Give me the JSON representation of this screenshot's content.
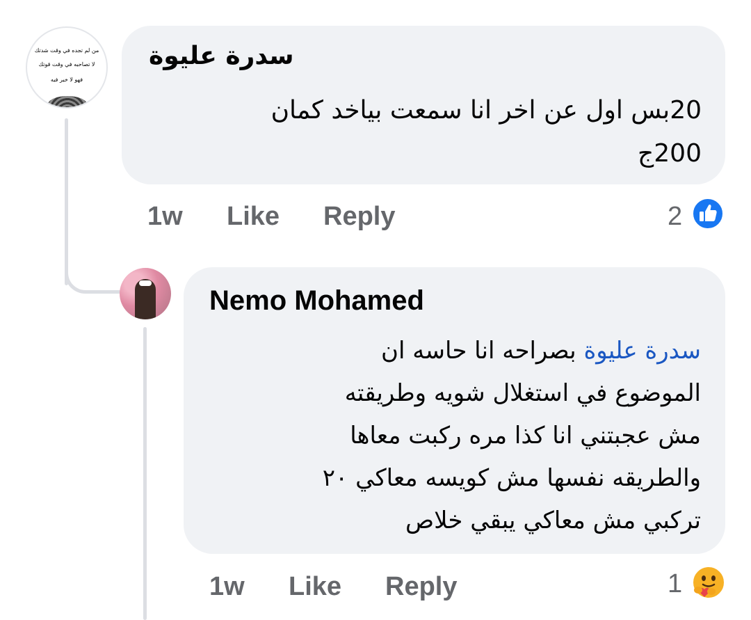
{
  "comments": [
    {
      "author": "سدرة عليوة",
      "avatar_text": {
        "line1": "من لم تجده في وقت شدتك",
        "line2": "لا تصاحبه في وقت قوتك",
        "line3": "فهو لا خير فيه"
      },
      "text_lines": [
        "20بس اول عن اخر انا سمعت بياخد كمان",
        "200ج"
      ],
      "time": "1w",
      "like_label": "Like",
      "reply_label": "Reply",
      "reaction_count": "2",
      "reaction_icon": "like-icon"
    },
    {
      "author": "Nemo Mohamed",
      "mention": "سدرة عليوة",
      "text_lines": [
        "بصراحه انا حاسه ان",
        "الموضوع في استغلال شويه وطريقته",
        "مش عجبتني انا كذا مره ركبت معاها",
        "والطريقه نفسها مش كويسه معاكي ٢٠",
        "تركبي مش معاكي يبقي خلاص"
      ],
      "time": "1w",
      "like_label": "Like",
      "reply_label": "Reply",
      "reaction_count": "1",
      "reaction_icon": "care-icon"
    }
  ],
  "colors": {
    "bubble": "#f0f2f5",
    "meta_text": "#65676b",
    "mention": "#1a57c2",
    "like_blue": "#1877f2",
    "thread_line": "#dcdee3"
  }
}
